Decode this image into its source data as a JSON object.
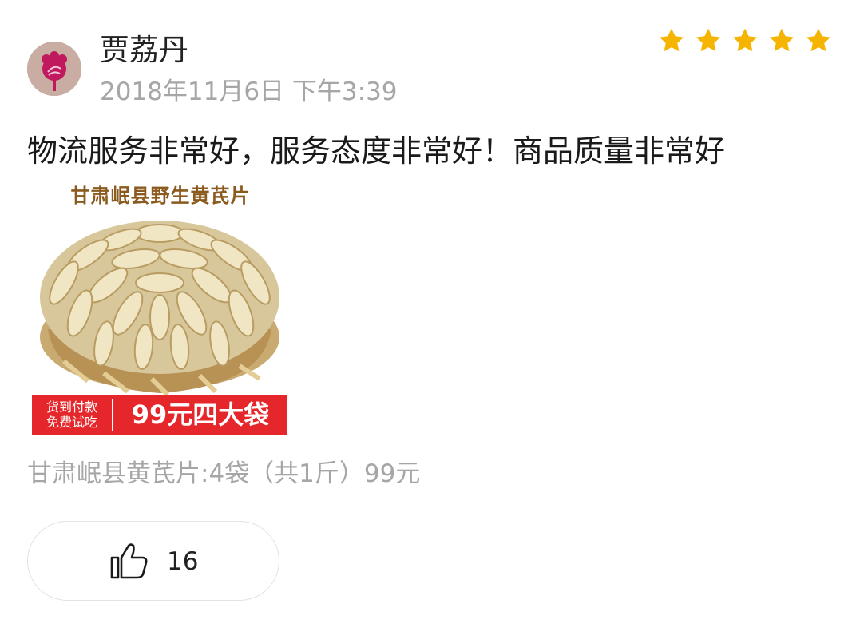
{
  "review": {
    "username": "贾荔丹",
    "timestamp": "2018年11月6日 下午3:39",
    "rating": 5,
    "text": "物流服务非常好，服务态度非常好！商品质量非常好",
    "product_spec": "甘肃岷县黄芪片:4袋（共1斤）99元"
  },
  "product_image": {
    "title": "甘肃岷县野生黄芪片",
    "banner_line1": "货到付款",
    "banner_line2": "免费试吃",
    "banner_main": "99元四大袋"
  },
  "like": {
    "count": "16"
  },
  "colors": {
    "star": "#f5b400",
    "banner": "#e5262b",
    "muted_text": "#a6a6a6"
  },
  "icons": [
    "avatar",
    "star-icon",
    "thumbs-up-icon"
  ]
}
